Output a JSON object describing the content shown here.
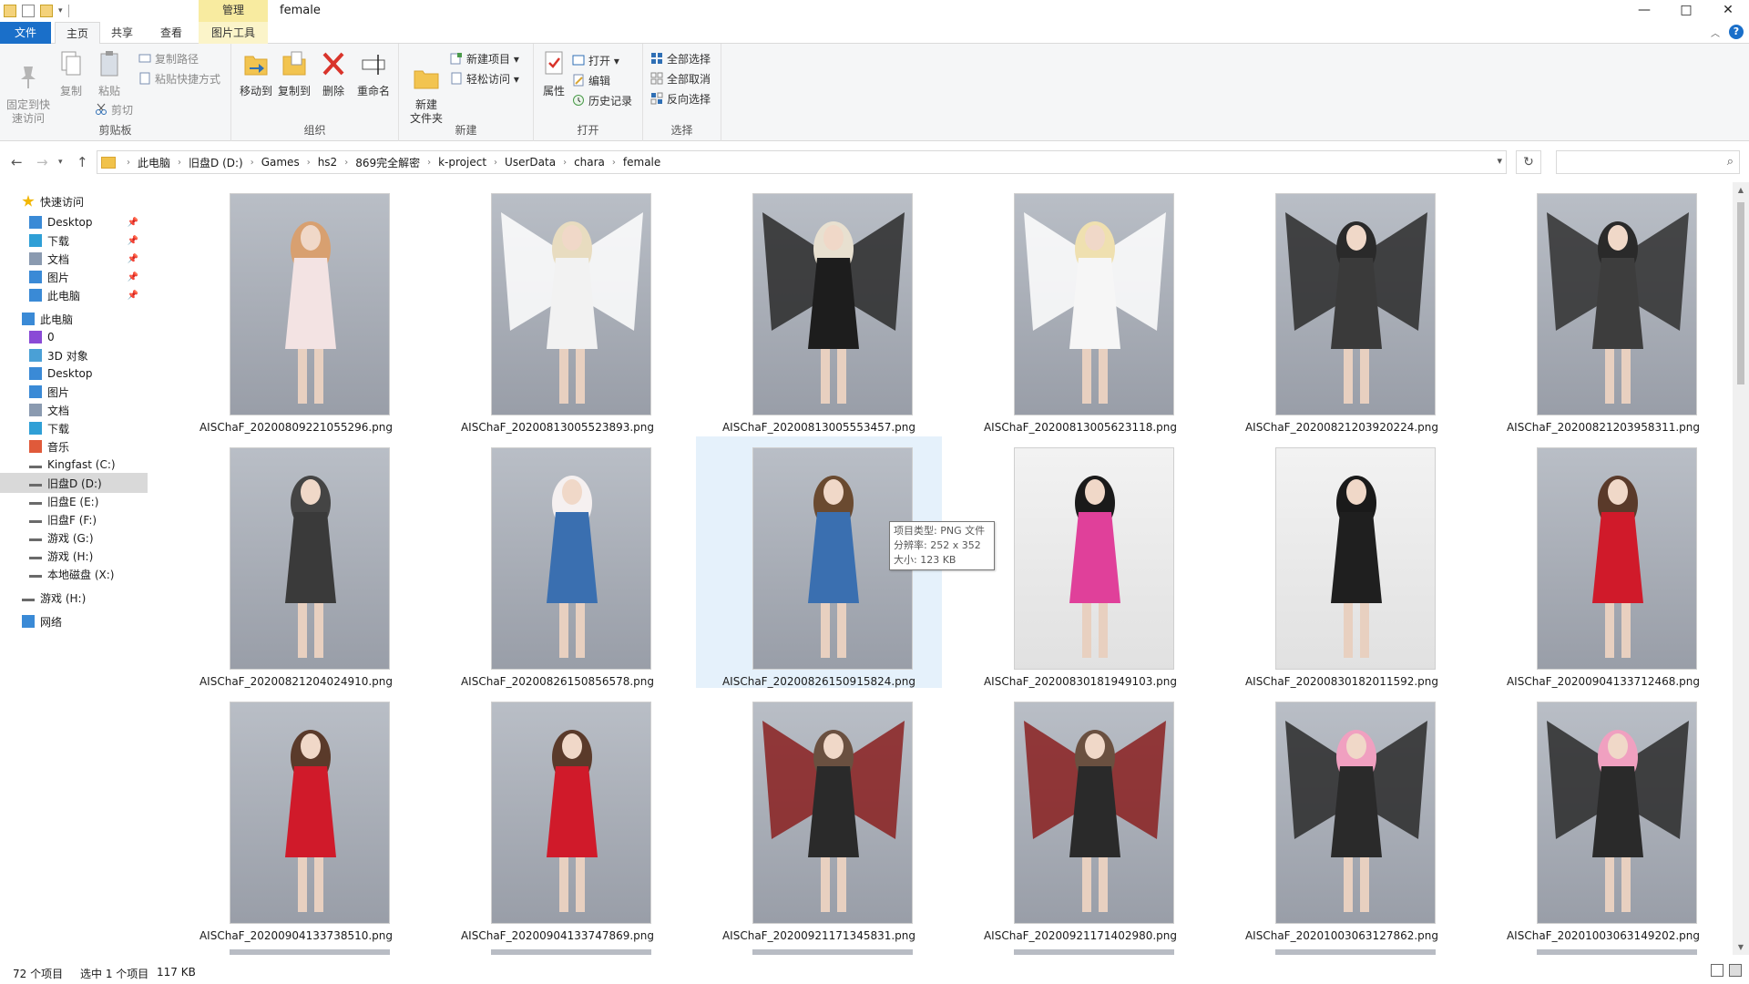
{
  "window": {
    "title": "female",
    "context_tab_top": "管理",
    "controls": [
      "—",
      "□",
      "✕"
    ]
  },
  "tabs": {
    "file": "文件",
    "home": "主页",
    "share": "共享",
    "view": "查看",
    "picture_tools": "图片工具"
  },
  "ribbon": {
    "clipboard": {
      "label": "剪贴板",
      "pin": "固定到快\n速访问",
      "copy": "复制",
      "paste": "粘贴",
      "copy_path": "复制路径",
      "paste_shortcut": "粘贴快捷方式",
      "cut": "剪切"
    },
    "organize": {
      "label": "组织",
      "move_to": "移动到",
      "copy_to": "复制到",
      "delete": "删除",
      "rename": "重命名"
    },
    "new": {
      "label": "新建",
      "new_folder": "新建\n文件夹",
      "new_item": "新建项目 ▾",
      "easy_access": "轻松访问 ▾"
    },
    "open": {
      "label": "打开",
      "properties": "属性",
      "open": "打开 ▾",
      "edit": "编辑",
      "history": "历史记录"
    },
    "select": {
      "label": "选择",
      "select_all": "全部选择",
      "select_none": "全部取消",
      "invert": "反向选择"
    }
  },
  "address": {
    "crumbs": [
      "此电脑",
      "旧盘D (D:)",
      "Games",
      "hs2",
      "869完全解密",
      "k-project",
      "UserData",
      "chara",
      "female"
    ],
    "search_placeholder": ""
  },
  "nav": {
    "quick_access": "快速访问",
    "items": [
      {
        "label": "快速访问",
        "icon": "star-icon",
        "indent": 0,
        "pin": false
      },
      {
        "label": "Desktop",
        "icon": "desktop-icon",
        "indent": 1,
        "pin": true
      },
      {
        "label": "下载",
        "icon": "download-icon",
        "indent": 1,
        "pin": true
      },
      {
        "label": "文档",
        "icon": "document-icon",
        "indent": 1,
        "pin": true
      },
      {
        "label": "图片",
        "icon": "pictures-icon",
        "indent": 1,
        "pin": true
      },
      {
        "label": "此电脑",
        "icon": "computer-icon",
        "indent": 1,
        "pin": true
      },
      {
        "label": "此电脑",
        "icon": "computer-icon",
        "indent": 0,
        "pin": false
      },
      {
        "label": "0",
        "icon": "video-icon",
        "indent": 1,
        "pin": false
      },
      {
        "label": "3D 对象",
        "icon": "cube-icon",
        "indent": 1,
        "pin": false
      },
      {
        "label": "Desktop",
        "icon": "desktop-icon",
        "indent": 1,
        "pin": false
      },
      {
        "label": "图片",
        "icon": "pictures-icon",
        "indent": 1,
        "pin": false
      },
      {
        "label": "文档",
        "icon": "document-icon",
        "indent": 1,
        "pin": false
      },
      {
        "label": "下载",
        "icon": "download-icon",
        "indent": 1,
        "pin": false
      },
      {
        "label": "音乐",
        "icon": "music-icon",
        "indent": 1,
        "pin": false
      },
      {
        "label": "Kingfast (C:)",
        "icon": "drive-icon",
        "indent": 1,
        "pin": false
      },
      {
        "label": "旧盘D (D:)",
        "icon": "drive-icon",
        "indent": 1,
        "pin": false
      },
      {
        "label": "旧盘E (E:)",
        "icon": "drive-icon",
        "indent": 1,
        "pin": false
      },
      {
        "label": "旧盘F (F:)",
        "icon": "drive-icon",
        "indent": 1,
        "pin": false
      },
      {
        "label": "游戏 (G:)",
        "icon": "drive-icon",
        "indent": 1,
        "pin": false
      },
      {
        "label": "游戏 (H:)",
        "icon": "drive-icon",
        "indent": 1,
        "pin": false
      },
      {
        "label": "本地磁盘 (X:)",
        "icon": "drive-icon",
        "indent": 1,
        "pin": false
      },
      {
        "label": "游戏 (H:)",
        "icon": "drive-icon",
        "indent": 0,
        "pin": false
      },
      {
        "label": "网络",
        "icon": "network-icon",
        "indent": 0,
        "pin": false
      }
    ]
  },
  "files": [
    {
      "name": "AISChaF_20200809221055296.png",
      "bg": "grey",
      "outfit": "#f3e3e3",
      "hair": "#d8a070",
      "wings": ""
    },
    {
      "name": "AISChaF_20200813005523893.png",
      "bg": "grey",
      "outfit": "#f2f2f2",
      "hair": "#e8dcc0",
      "wings": "#ffffff"
    },
    {
      "name": "AISChaF_20200813005553457.png",
      "bg": "grey",
      "outfit": "#1d1d1d",
      "hair": "#e8e0d0",
      "wings": "#2a2a2a"
    },
    {
      "name": "AISChaF_20200813005623118.png",
      "bg": "grey",
      "outfit": "#f6f6f6",
      "hair": "#efe0b0",
      "wings": "#ffffff"
    },
    {
      "name": "AISChaF_20200821203920224.png",
      "bg": "grey",
      "outfit": "#3a3a3a",
      "hair": "#2a2a2a",
      "wings": "#2b2b2b"
    },
    {
      "name": "AISChaF_20200821203958311.png",
      "bg": "grey",
      "outfit": "#3d3d3d",
      "hair": "#2a2a2a",
      "wings": "#303030"
    },
    {
      "name": "AISChaF_20200821204024910.png",
      "bg": "grey",
      "outfit": "#3a3a3a",
      "hair": "#444444",
      "wings": ""
    },
    {
      "name": "AISChaF_20200826150856578.png",
      "bg": "grey",
      "outfit": "#3a6fb0",
      "hair": "#f5f0f0",
      "wings": ""
    },
    {
      "name": "AISChaF_20200826150915824.png",
      "bg": "grey",
      "outfit": "#3a6fb0",
      "hair": "#6a4a30",
      "wings": ""
    },
    {
      "name": "AISChaF_20200830181949103.png",
      "bg": "white",
      "outfit": "#e0409a",
      "hair": "#1a1a1a",
      "wings": ""
    },
    {
      "name": "AISChaF_20200830182011592.png",
      "bg": "white",
      "outfit": "#1f1f1f",
      "hair": "#1a1a1a",
      "wings": ""
    },
    {
      "name": "AISChaF_20200904133712468.png",
      "bg": "grey",
      "outfit": "#d01a2a",
      "hair": "#5a3a2a",
      "wings": ""
    },
    {
      "name": "AISChaF_20200904133738510.png",
      "bg": "grey",
      "outfit": "#d01a2a",
      "hair": "#5a3a2a",
      "wings": ""
    },
    {
      "name": "AISChaF_20200904133747869.png",
      "bg": "grey",
      "outfit": "#d01a2a",
      "hair": "#5a3a2a",
      "wings": ""
    },
    {
      "name": "AISChaF_20200921171345831.png",
      "bg": "grey",
      "outfit": "#2a2a2a",
      "hair": "#6a5040",
      "wings": "#8a2020"
    },
    {
      "name": "AISChaF_20200921171402980.png",
      "bg": "grey",
      "outfit": "#2a2a2a",
      "hair": "#6a5040",
      "wings": "#8a2020"
    },
    {
      "name": "AISChaF_20201003063127862.png",
      "bg": "grey",
      "outfit": "#2a2a2a",
      "hair": "#f0a0c0",
      "wings": "#2a2a2a"
    },
    {
      "name": "AISChaF_20201003063149202.png",
      "bg": "grey",
      "outfit": "#2a2a2a",
      "hair": "#f0a0c0",
      "wings": "#2a2a2a"
    }
  ],
  "selected_index": 8,
  "tooltip": {
    "line1": "项目类型: PNG 文件",
    "line2": "分辨率: 252 x 352",
    "line3": "大小: 123 KB"
  },
  "status": {
    "count": "72 个项目",
    "selection": "选中 1 个项目",
    "size": "117 KB"
  }
}
